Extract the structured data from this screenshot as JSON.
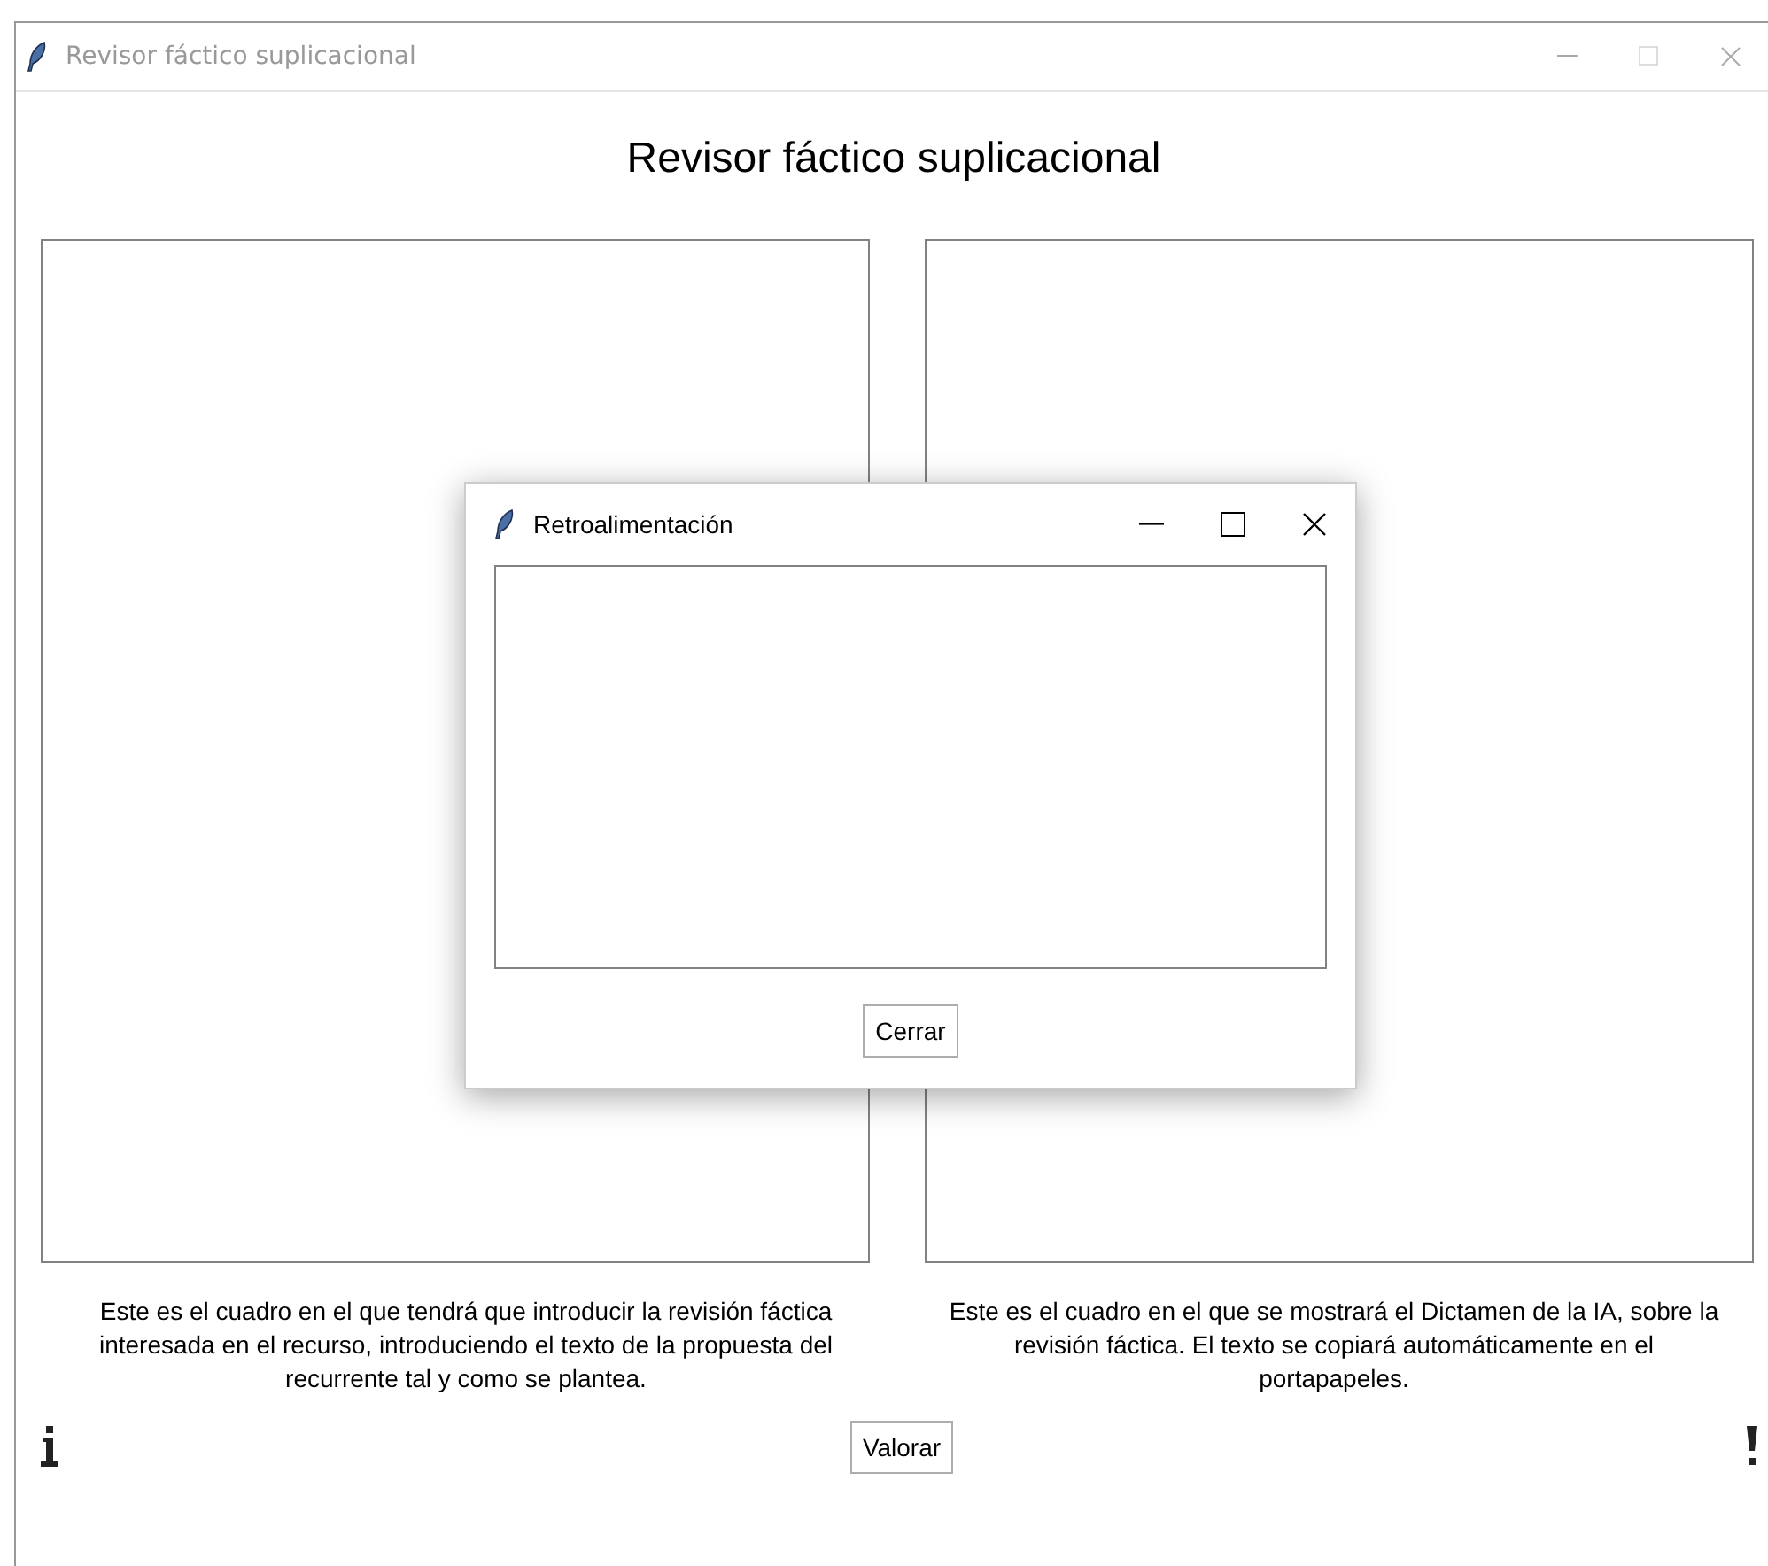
{
  "window": {
    "title": "Revisor fáctico suplicacional",
    "active": false
  },
  "heading": "Revisor fáctico suplicacional",
  "descriptions": [
    "Este es el cuadro en el que tendrá que introducir la revisión fáctica interesada en el recurso, introduciendo el texto de la propuesta del recurrente tal y como se plantea.",
    "Este es el cuadro en el que se mostrará el Dictamen de la IA, sobre la revisión fáctica. El texto se copiará automáticamente en el portapapeles."
  ],
  "button": "Valorar",
  "dialog": {
    "title": "Retroalimentación",
    "button": "Cerrar"
  }
}
